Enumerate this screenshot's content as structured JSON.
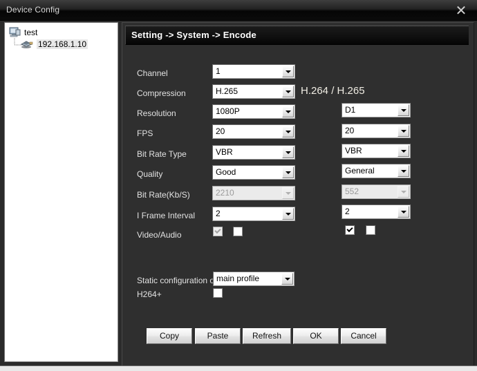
{
  "window": {
    "title": "Device Config",
    "close_icon": "close-icon"
  },
  "tree": {
    "root": {
      "label": "test",
      "icon": "computer-icon"
    },
    "child": {
      "label": "192.168.1.10",
      "icon": "device-camera-icon"
    }
  },
  "panel": {
    "header": "Setting -> System -> Encode",
    "codec_title": "H.264 / H.265"
  },
  "form": {
    "rows": [
      {
        "label": "Channel",
        "main": "1",
        "sub": null,
        "main_disabled": false,
        "sub_disabled": false
      },
      {
        "label": "Compression",
        "main": "H.265",
        "sub": null,
        "main_disabled": false,
        "sub_disabled": false
      },
      {
        "label": "Resolution",
        "main": "1080P",
        "sub": "D1",
        "main_disabled": false,
        "sub_disabled": false
      },
      {
        "label": "FPS",
        "main": "20",
        "sub": "20",
        "main_disabled": false,
        "sub_disabled": false
      },
      {
        "label": "Bit Rate Type",
        "main": "VBR",
        "sub": "VBR",
        "main_disabled": false,
        "sub_disabled": false
      },
      {
        "label": "Quality",
        "main": "Good",
        "sub": "General",
        "main_disabled": false,
        "sub_disabled": false
      },
      {
        "label": "Bit Rate(Kb/S)",
        "main": "2210",
        "sub": "552",
        "main_disabled": true,
        "sub_disabled": true
      },
      {
        "label": "I Frame Interval",
        "main": "2",
        "sub": "2",
        "main_disabled": false,
        "sub_disabled": false
      }
    ],
    "video_audio": {
      "label": "Video/Audio",
      "main_video_checked": true,
      "main_video_disabled": true,
      "main_audio_checked": false,
      "sub_video_checked": true,
      "sub_audio_checked": false
    },
    "static_config": {
      "label": "Static configuration of",
      "value": "main profile"
    },
    "h264plus": {
      "label": "H264+",
      "checked": false
    }
  },
  "buttons": [
    {
      "label": "Copy"
    },
    {
      "label": "Paste"
    },
    {
      "label": "Refresh"
    },
    {
      "label": "OK"
    },
    {
      "label": "Cancel"
    }
  ]
}
